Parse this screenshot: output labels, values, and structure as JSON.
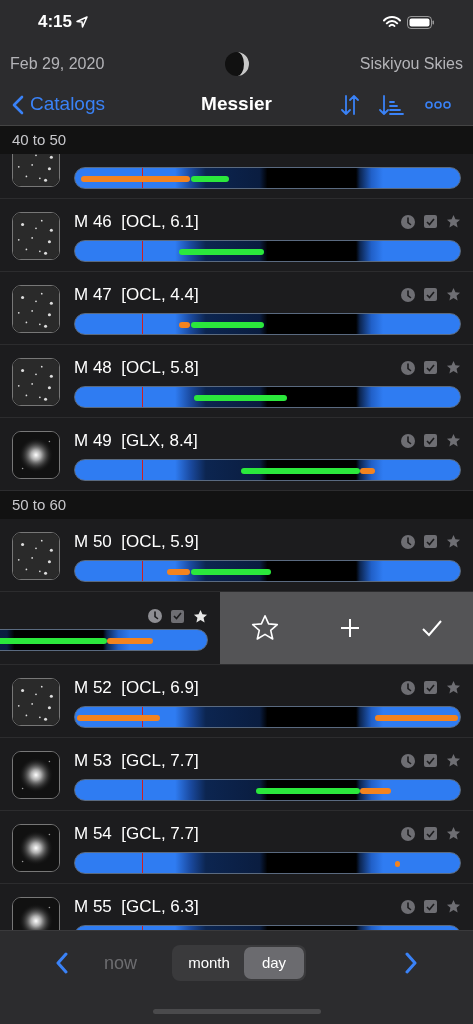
{
  "status_bar": {
    "time": "4:15"
  },
  "info": {
    "date": "Feb 29, 2020",
    "location": "Siskiyou Skies"
  },
  "nav": {
    "back": "Catalogs",
    "title": "Messier"
  },
  "sections": [
    {
      "title": "40 to 50",
      "rows": [
        {
          "partial": true,
          "kind": "stars"
        },
        {
          "name": "M 46  [OCL, 6.1]",
          "checked": true,
          "starred": false,
          "kind": "stars"
        },
        {
          "name": "M 47  [OCL, 4.4]",
          "checked": true,
          "starred": false,
          "kind": "stars"
        },
        {
          "name": "M 48  [OCL, 5.8]",
          "checked": true,
          "starred": false,
          "kind": "stars"
        },
        {
          "name": "M 49  [GLX, 8.4]",
          "checked": true,
          "starred": false,
          "kind": "glow"
        }
      ]
    },
    {
      "title": "50 to 60",
      "rows": [
        {
          "name": "M 50  [OCL, 5.9]",
          "checked": true,
          "starred": false,
          "kind": "stars"
        },
        {
          "swiped": true,
          "checked": true,
          "starred": true
        },
        {
          "name": "M 52  [OCL, 6.9]",
          "checked": true,
          "starred": false,
          "kind": "stars"
        },
        {
          "name": "M 53  [GCL, 7.7]",
          "checked": true,
          "starred": false,
          "kind": "glow"
        },
        {
          "name": "M 54  [GCL, 7.7]",
          "checked": true,
          "starred": false,
          "kind": "glow"
        },
        {
          "name": "M 55  [GCL, 6.3]",
          "checked": true,
          "starred": false,
          "kind": "glow"
        }
      ]
    }
  ],
  "toolbar": {
    "now": {
      "label": "now",
      "disabled": true
    },
    "segments": [
      {
        "label": "month",
        "selected": false
      },
      {
        "label": "day",
        "selected": true
      }
    ]
  }
}
